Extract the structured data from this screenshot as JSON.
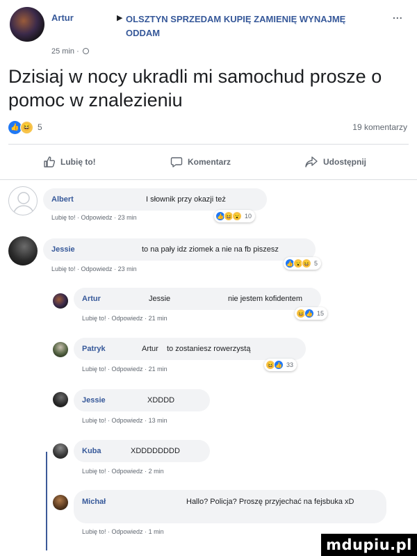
{
  "post": {
    "author": "Artur",
    "arrow": "▶",
    "group": "OLSZTYN SPRZEDAM KUPIĘ ZAMIENIĘ WYNAJMĘ ODDAM",
    "more": "...",
    "time": "25 min ·",
    "text": "Dzisiaj w nocy ukradli mi samochud prosze o pomoc w znalezieniu",
    "reaction_count": "5",
    "comments_count": "19 komentarzy",
    "reaction_icons": [
      "like-icon",
      "haha-icon"
    ]
  },
  "actions": {
    "like_label": "Lubię to!",
    "comment_label": "Komentarz",
    "share_label": "Udostępnij"
  },
  "comment_action_words": {
    "like": "Lubię to!",
    "reply": "Odpowiedz"
  },
  "comments": [
    {
      "name": "Albert",
      "text": "I słownik przy okazji też",
      "time": "23 min",
      "reactions": "10",
      "reaction_icons": [
        "like-icon",
        "haha-icon",
        "wow-icon"
      ]
    },
    {
      "name": "Jessie",
      "text": "to na pały idz ziomek a nie na fb piszesz",
      "time": "23 min",
      "reactions": "5",
      "reaction_icons": [
        "like-icon",
        "wow-icon",
        "haha-icon"
      ]
    },
    {
      "name": "Artur",
      "mention": "Jessie",
      "text": "nie jestem kofidentem",
      "time": "21 min",
      "reactions": "15",
      "reaction_icons": [
        "haha-icon",
        "like-icon"
      ]
    },
    {
      "name": "Patryk",
      "mention": "Artur",
      "text": "to zostaniesz rowerzystą",
      "time": "21 min",
      "reactions": "33",
      "reaction_icons": [
        "haha-icon",
        "like-icon"
      ]
    },
    {
      "name": "Jessie",
      "text": "XDDDD",
      "time": "13 min"
    },
    {
      "name": "Kuba",
      "text": "XDDDDDDDD",
      "time": "2 min"
    },
    {
      "name": "Michał",
      "text": "Hallo? Policja? Proszę przyjechać na fejsbuka xD",
      "time": "1 min"
    }
  ],
  "watermark": "mdupiu.pl",
  "colors": {
    "link": "#365899",
    "like": "#2078f4",
    "haha": "#f7c44c",
    "bubble": "#f2f3f5",
    "thread": "#3b5998"
  }
}
